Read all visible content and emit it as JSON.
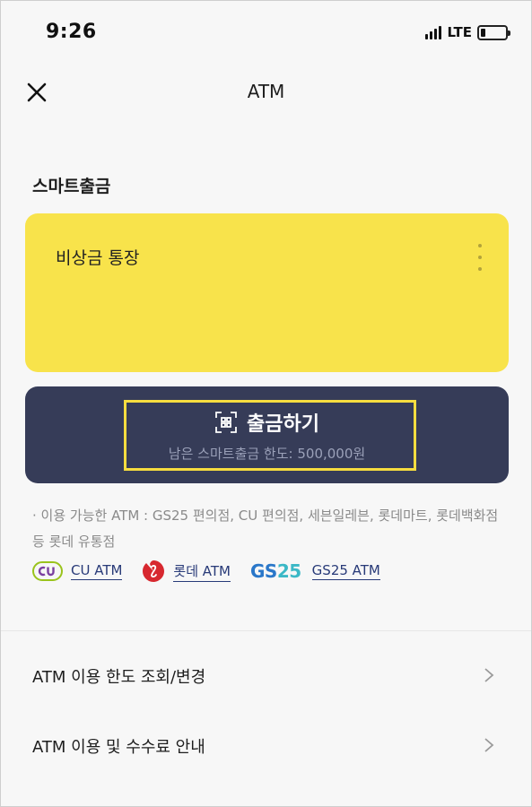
{
  "status_bar": {
    "time": "9:26",
    "network": "LTE",
    "battery_level": 0.2
  },
  "nav": {
    "title": "ATM",
    "close_icon": "close-icon"
  },
  "section": {
    "title": "스마트출금"
  },
  "account": {
    "name": "비상금 통장",
    "more_icon": "more-vertical-icon"
  },
  "withdraw": {
    "icon": "scan-icon",
    "label": "출금하기",
    "limit_text": "남은 스마트출금 한도: 500,000원"
  },
  "notice": {
    "text": "· 이용 가능한 ATM : GS25 편의점, CU 편의점, 세븐일레븐, 롯데마트, 롯데백화점 등 롯데 유통점"
  },
  "atm_links": [
    {
      "logo": "CU",
      "label": "CU ATM"
    },
    {
      "logo": "lotte-logo",
      "label": "롯데 ATM"
    },
    {
      "logo": "GS25",
      "label": "GS25 ATM"
    }
  ],
  "menu": [
    {
      "label": "ATM 이용 한도 조회/변경"
    },
    {
      "label": "ATM 이용 및 수수료 안내"
    }
  ],
  "colors": {
    "account_card": "#f8e34b",
    "withdraw_card": "#363c58",
    "highlight": "#f7dd3f",
    "link": "#283a78",
    "cu_purple": "#7a3fa0",
    "cu_green": "#9ac31c",
    "lotte_red": "#d7282f",
    "gs_blue": "#2a77c9",
    "gs_teal": "#3bb8c6"
  }
}
